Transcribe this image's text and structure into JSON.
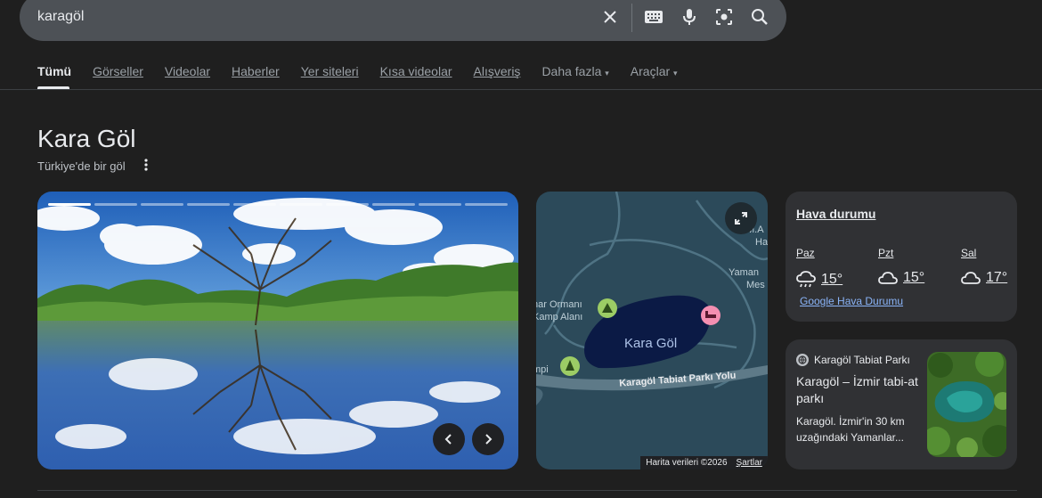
{
  "search": {
    "query": "karagöl"
  },
  "tabs": [
    "Tümü",
    "Görseller",
    "Videolar",
    "Haberler",
    "Yer siteleri",
    "Kısa videolar",
    "Alışveriş"
  ],
  "tab_more": "Daha fazla",
  "tab_tools": "Araçlar",
  "entity": {
    "title": "Kara Göl",
    "subtitle": "Türkiye'de bir göl"
  },
  "photo_carousel": {
    "slide_count": 10,
    "current_slide": 1
  },
  "map": {
    "lake_label": "Kara Göl",
    "road_label": "Karagöl Tabiat Parkı Yolu",
    "poi_left_1": "nar Ormanı",
    "poi_left_2": "Kamp Alanı",
    "poi_left_3": "mpi",
    "poi_right_1": "M.A",
    "poi_right_2": "Ha",
    "poi_right_3": "Yaman",
    "poi_right_4": "Mes",
    "data_credit": "Harita verileri ©2026",
    "terms": "Şartlar"
  },
  "weather": {
    "title": "Hava durumu",
    "days": [
      {
        "day": "Paz",
        "temp": "15°",
        "icon": "rain-cloud-icon"
      },
      {
        "day": "Pzt",
        "temp": "15°",
        "icon": "cloud-icon"
      },
      {
        "day": "Sal",
        "temp": "17°",
        "icon": "cloud-icon"
      }
    ],
    "link": "Google Hava Durumu"
  },
  "article": {
    "source": "Karagöl Tabiat Parkı",
    "title": "Karagöl – İzmir tabi-at parkı",
    "snippet": "Karagöl. İzmir'in 30 km uzağındaki Yamanlar..."
  },
  "colors": {
    "background": "#1f1f1f",
    "card": "#303134",
    "link": "#8ab4f8",
    "map_water": "#0b1a45",
    "map_land": "#2c4a5a"
  }
}
